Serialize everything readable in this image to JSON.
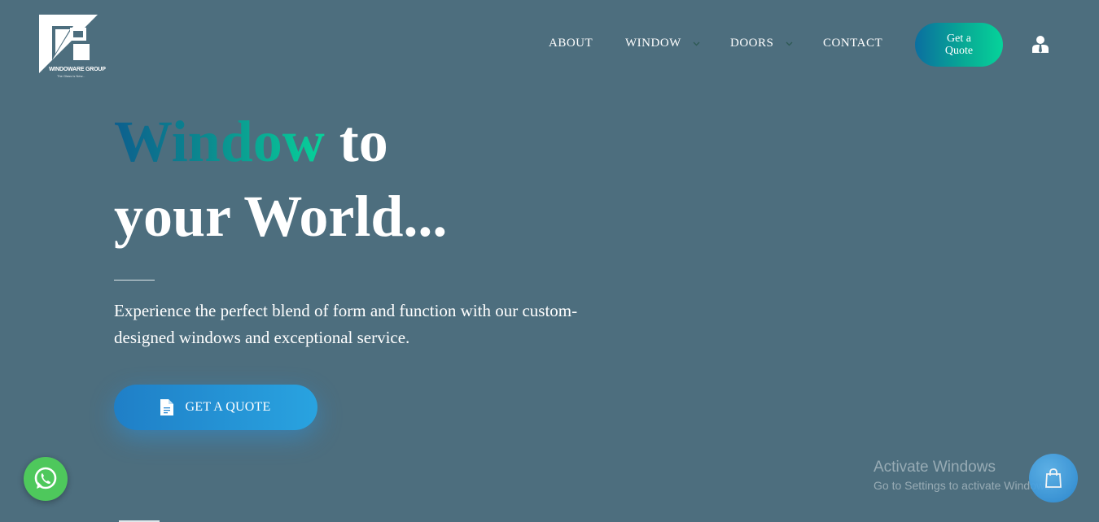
{
  "brand": {
    "name": "WINDOWARE GROUP",
    "tagline": "The Glass is New..."
  },
  "nav": {
    "items": [
      {
        "label": "ABOUT",
        "has_dropdown": false
      },
      {
        "label": "WINDOW",
        "has_dropdown": true
      },
      {
        "label": "DOORS",
        "has_dropdown": true
      },
      {
        "label": "CONTACT",
        "has_dropdown": false
      }
    ],
    "quote_button": "Get a Quote",
    "user_icon": "user-icon"
  },
  "hero": {
    "title_highlight": "Window",
    "title_rest_line1": " to",
    "title_line2": "your World...",
    "subtitle": "Experience the perfect blend of form and function with our custom-designed windows and exceptional service.",
    "cta_label": "GET A QUOTE",
    "cta_icon": "document-icon"
  },
  "overlay": {
    "activate_title": "Activate Windows",
    "activate_sub": "Go to Settings to activate Windows."
  },
  "colors": {
    "background": "#4d6e7e",
    "accent_gradient_start": "#0c5f8e",
    "accent_gradient_end": "#07d39a",
    "cta_blue": "#29a3e0",
    "whatsapp_green": "#4ec85c"
  }
}
